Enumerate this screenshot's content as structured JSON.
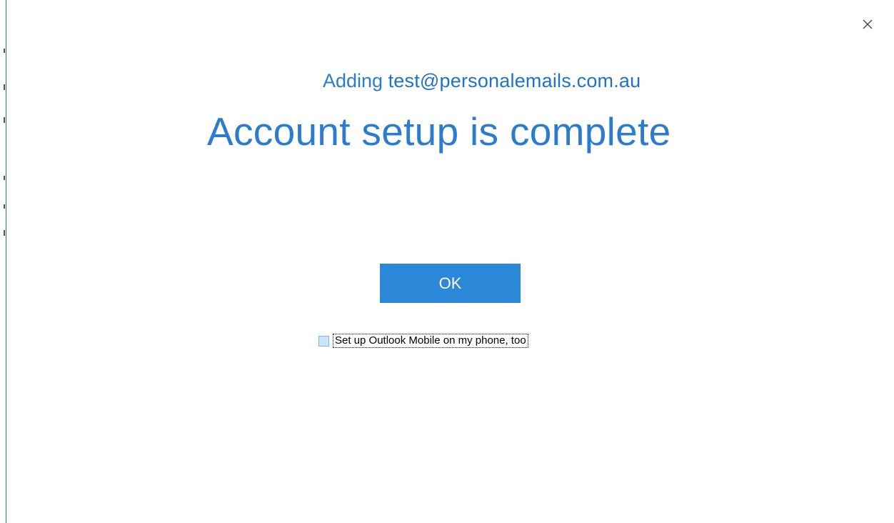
{
  "dialog": {
    "close_icon": "close-icon",
    "adding_prefix": "Adding",
    "email": "test@personalemails.com.au",
    "title": "Account setup is complete",
    "ok_label": "OK",
    "mobile_checkbox": {
      "label": "Set up Outlook Mobile on my phone, too",
      "checked": false
    }
  },
  "colors": {
    "accent": "#2b7cd0",
    "button": "#2b88d8",
    "checkbox_fill": "#cce4f7"
  }
}
